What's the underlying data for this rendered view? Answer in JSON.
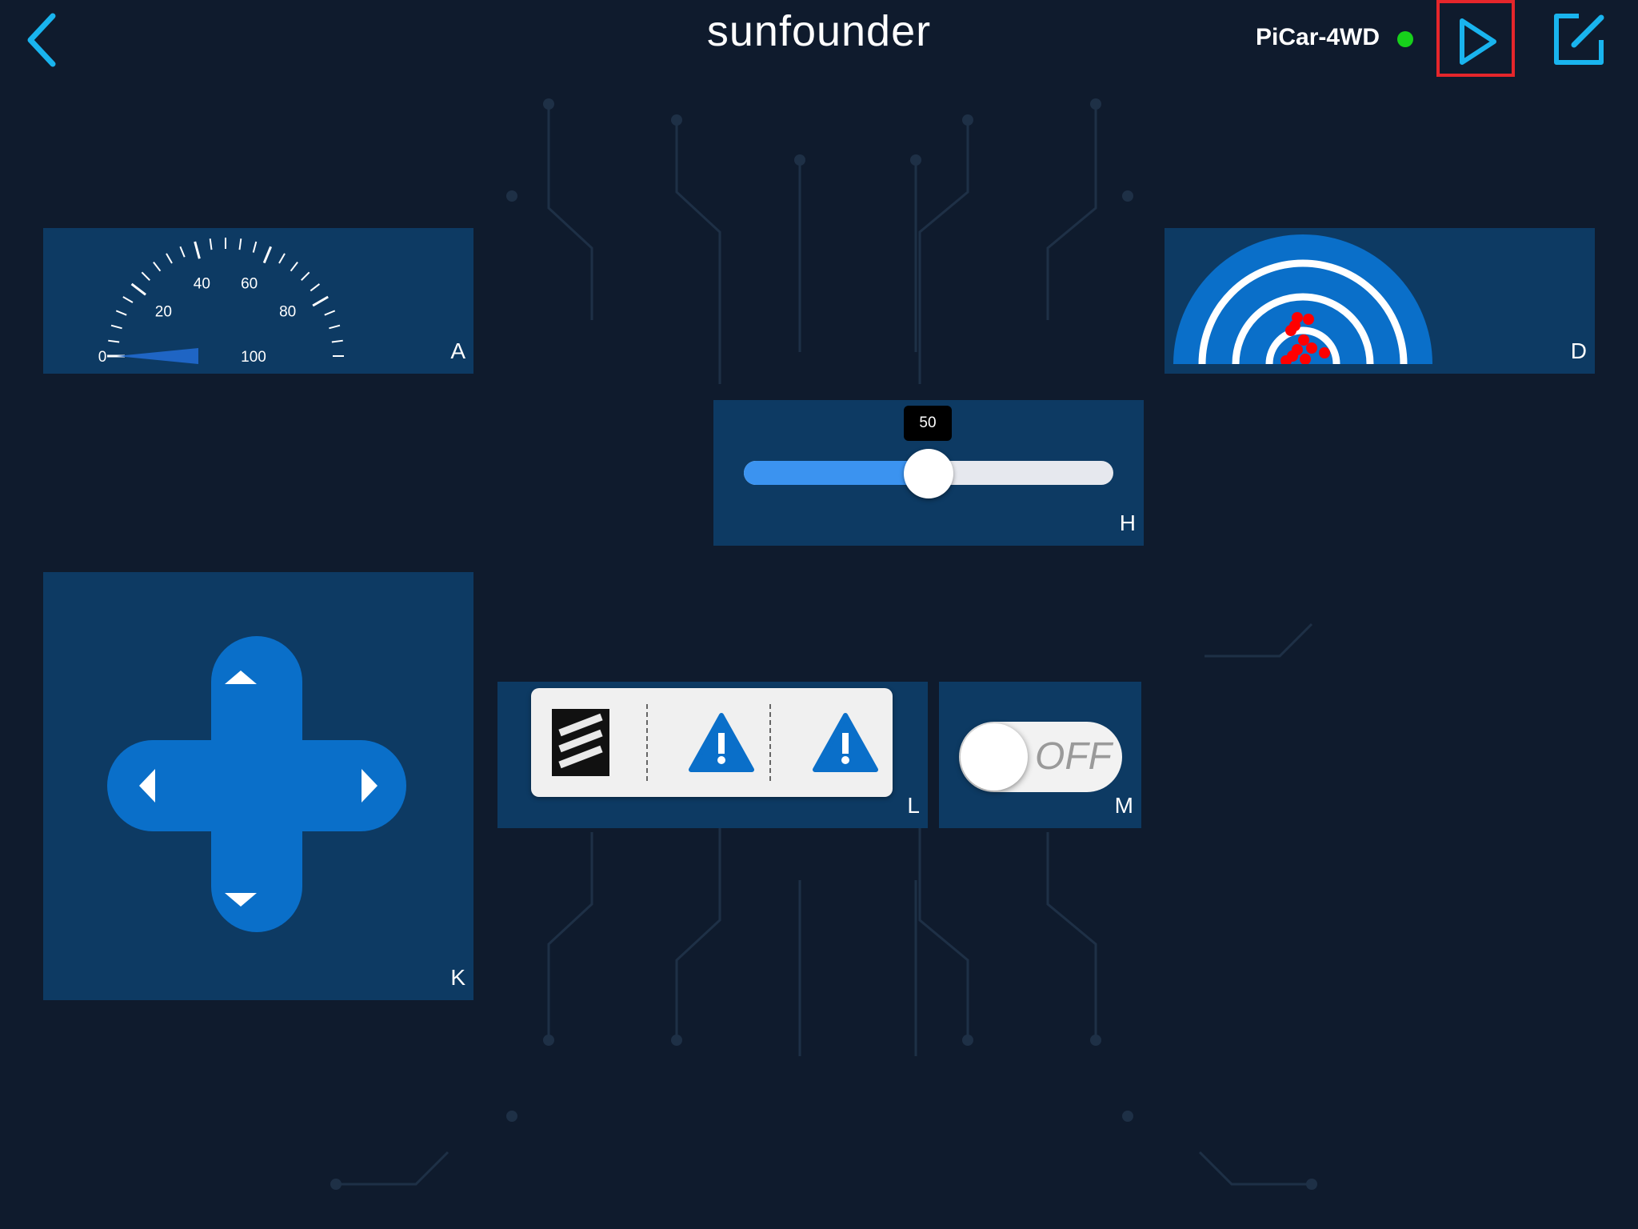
{
  "header": {
    "title": "sunfounder",
    "device_name": "PiCar-4WD",
    "status_color": "#17d11b",
    "back_icon": "chevron-left-icon",
    "run_icon": "play-icon",
    "edit_icon": "edit-icon",
    "accent_color": "#19b4ee"
  },
  "widgets": {
    "speedometer": {
      "label": "A",
      "ticks": [
        "0",
        "20",
        "40",
        "60",
        "80",
        "100"
      ],
      "value": 0
    },
    "radar": {
      "label": "D",
      "color": "#0a6fc9",
      "points_color": "#ff0000"
    },
    "slider": {
      "label": "H",
      "value": "50",
      "min": 0,
      "max": 100,
      "fill_color": "#3b93f0"
    },
    "dpad": {
      "label": "K",
      "color": "#0a6fc9",
      "icons": [
        "arrow-up-icon",
        "arrow-down-icon",
        "arrow-left-icon",
        "arrow-right-icon"
      ]
    },
    "button_group": {
      "label": "L",
      "icons": [
        "stripes-icon",
        "warning-icon",
        "warning-icon"
      ]
    },
    "switch": {
      "label": "M",
      "state": "OFF"
    }
  }
}
